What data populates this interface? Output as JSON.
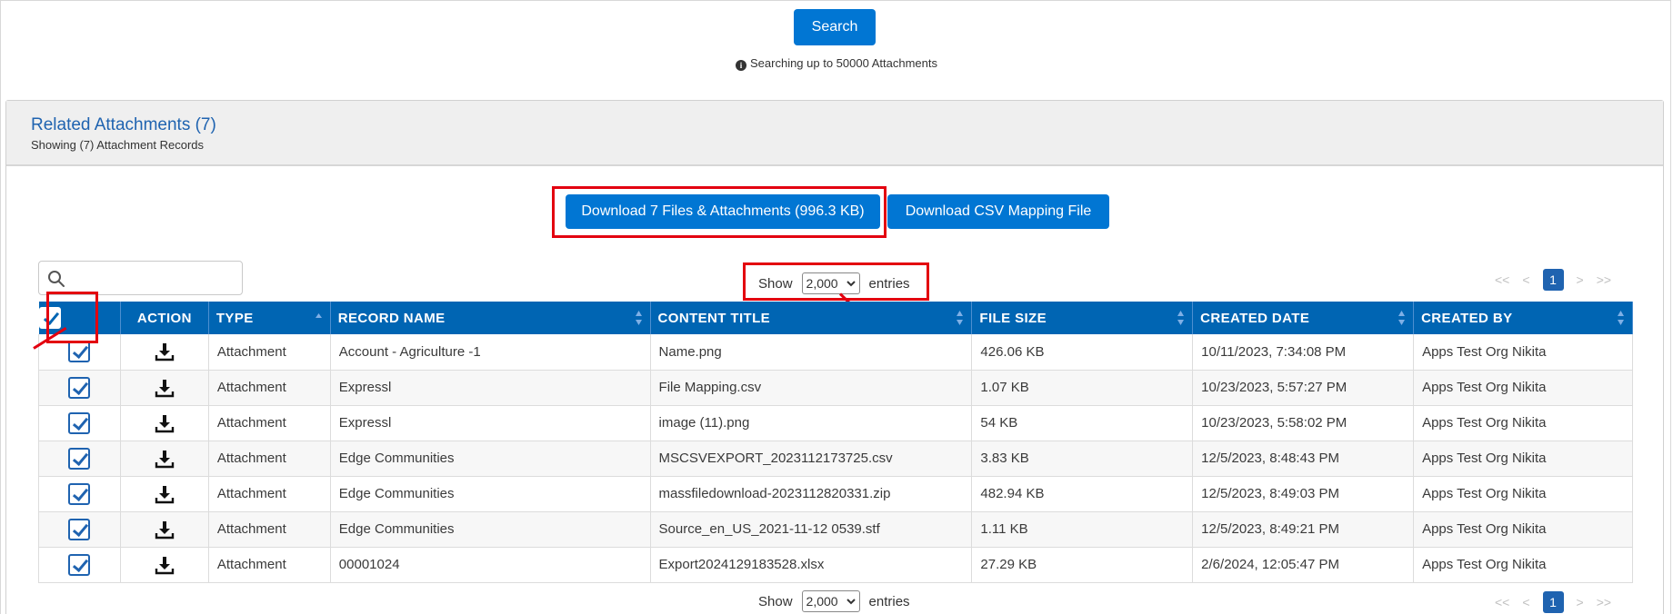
{
  "search": {
    "button_label": "Search",
    "note": "Searching up to 50000 Attachments",
    "note_icon": "info-icon"
  },
  "card": {
    "title": "Related Attachments (7)",
    "subtitle": "Showing (7) Attachment Records",
    "download_all_label": "Download 7 Files & Attachments (996.3 KB)",
    "download_csv_label": "Download CSV Mapping File"
  },
  "filter": {
    "search_placeholder": "",
    "search_icon": "search-icon"
  },
  "page_size": {
    "show_label": "Show",
    "value": "2,000",
    "entries_label": "entries"
  },
  "pager": {
    "first": "<<",
    "prev": "<",
    "current": "1",
    "next": ">",
    "last": ">>"
  },
  "table": {
    "columns": [
      "ACTION",
      "TYPE",
      "RECORD NAME",
      "CONTENT TITLE",
      "FILE SIZE",
      "CREATED DATE",
      "CREATED BY"
    ],
    "rows": [
      {
        "type": "Attachment",
        "record_name": "Account - Agriculture -1",
        "content_title": "Name.png",
        "file_size": "426.06 KB",
        "created_date": "10/11/2023, 7:34:08 PM",
        "created_by": "Apps Test Org Nikita"
      },
      {
        "type": "Attachment",
        "record_name": "Expressl",
        "content_title": "File Mapping.csv",
        "file_size": "1.07 KB",
        "created_date": "10/23/2023, 5:57:27 PM",
        "created_by": "Apps Test Org Nikita"
      },
      {
        "type": "Attachment",
        "record_name": "Expressl",
        "content_title": "image (11).png",
        "file_size": "54 KB",
        "created_date": "10/23/2023, 5:58:02 PM",
        "created_by": "Apps Test Org Nikita"
      },
      {
        "type": "Attachment",
        "record_name": "Edge Communities",
        "content_title": "MSCSVEXPORT_2023112173725.csv",
        "file_size": "3.83 KB",
        "created_date": "12/5/2023, 8:48:43 PM",
        "created_by": "Apps Test Org Nikita"
      },
      {
        "type": "Attachment",
        "record_name": "Edge Communities",
        "content_title": "massfiledownload-2023112820331.zip",
        "file_size": "482.94 KB",
        "created_date": "12/5/2023, 8:49:03 PM",
        "created_by": "Apps Test Org Nikita"
      },
      {
        "type": "Attachment",
        "record_name": "Edge Communities",
        "content_title": "Source_en_US_2021-11-12 0539.stf",
        "file_size": "1.11 KB",
        "created_date": "12/5/2023, 8:49:21 PM",
        "created_by": "Apps Test Org Nikita"
      },
      {
        "type": "Attachment",
        "record_name": "00001024",
        "content_title": "Export2024129183528.xlsx",
        "file_size": "27.29 KB",
        "created_date": "2/6/2024, 12:05:47 PM",
        "created_by": "Apps Test Org Nikita"
      }
    ]
  },
  "colors": {
    "primary": "#0176d3",
    "header": "#0065b3",
    "link": "#1f63b0",
    "annotation": "#e3000f"
  }
}
